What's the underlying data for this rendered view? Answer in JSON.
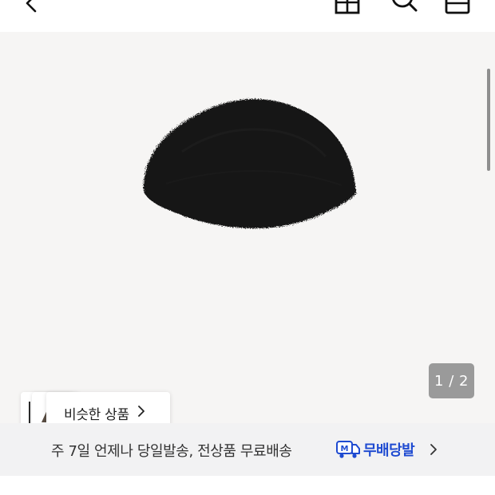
{
  "header": {
    "icons": [
      "back-icon",
      "store-icon",
      "search-icon",
      "cart-icon"
    ]
  },
  "gallery": {
    "image_description_icon": "black-fur-bucket-hat",
    "page_indicator": "1 / 2"
  },
  "similar_products": {
    "label": "비슷한 상품"
  },
  "shipping_banner": {
    "text": "주 7일 언제나 당일발송, 전상품 무료배송",
    "brand_name": "무배당발",
    "brand_color": "#1f4bd1"
  }
}
